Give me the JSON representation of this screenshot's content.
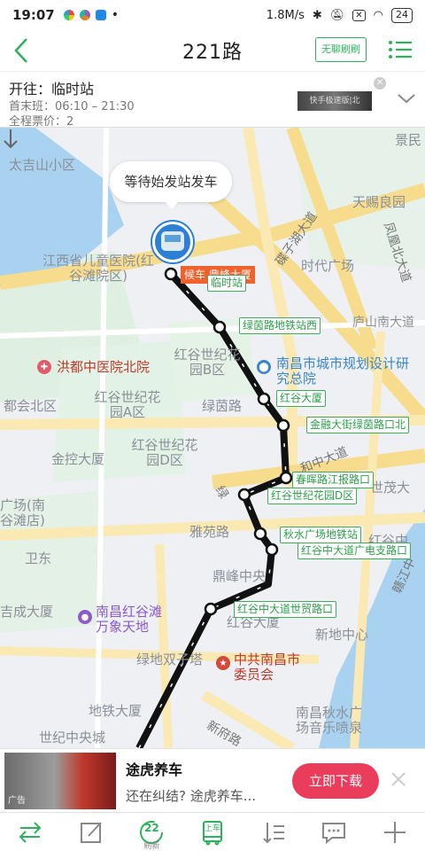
{
  "status_bar": {
    "time": "19:07",
    "net_speed": "1.8M/s",
    "battery": "24"
  },
  "header": {
    "title": "221路",
    "boring_button": "无聊刷刷"
  },
  "route_info": {
    "destination": "开往：临时站",
    "hours": "首末班：06:10 – 21:30",
    "fare": "全程票价：2",
    "ad_thumb_text": "快手极速版|北"
  },
  "map": {
    "waiting_bubble": "等待始发站发车",
    "bus_tag": "候车 鼎峰大厦",
    "stops": [
      {
        "label": "临时站"
      },
      {
        "label": "绿茵路地铁站西"
      },
      {
        "label": "红谷大厦"
      },
      {
        "label": "金融大街绿茵路口北"
      },
      {
        "label": "春晖路江报路口"
      },
      {
        "label": "红谷世纪花园D区"
      },
      {
        "label": "秋水广场地铁站"
      },
      {
        "label": "红谷中大道广电支路口"
      },
      {
        "label": "红谷中大道世贸路口"
      }
    ],
    "places": [
      "景民",
      "太吉山小区",
      "天赐良园",
      "碟子湖大道",
      "凤凰北大道",
      "时代广场",
      "江西省儿童医院(红谷滩院区)",
      "庐山南大道",
      "洪都中医院北院",
      "红谷世纪花园B区",
      "南昌市城市规划设计研究总院",
      "都会北区",
      "红谷世纪花园A区",
      "绿茵路",
      "红谷世纪花园D区",
      "金控大厦",
      "和中大道",
      "世茂大",
      "广场(南谷滩店)",
      "雅苑路",
      "红谷中",
      "卫东",
      "鼎峰中央",
      "赣江中",
      "吉成大厦",
      "南昌红谷滩万象天地",
      "红谷大厦",
      "新地中心",
      "绿地双子塔",
      "中共南昌市委员会",
      "地铁大厦",
      "世纪中央城",
      "新府路",
      "南昌秋水广场音乐喷泉",
      "绿"
    ]
  },
  "ad": {
    "title": "途虎养车",
    "subtitle": "还在纠结? 途虎养车...",
    "button": "立即下载",
    "tag": "广告"
  },
  "tabbar": {
    "center_badge": "22",
    "center_sub": "刷新",
    "bus_label": "上车"
  }
}
